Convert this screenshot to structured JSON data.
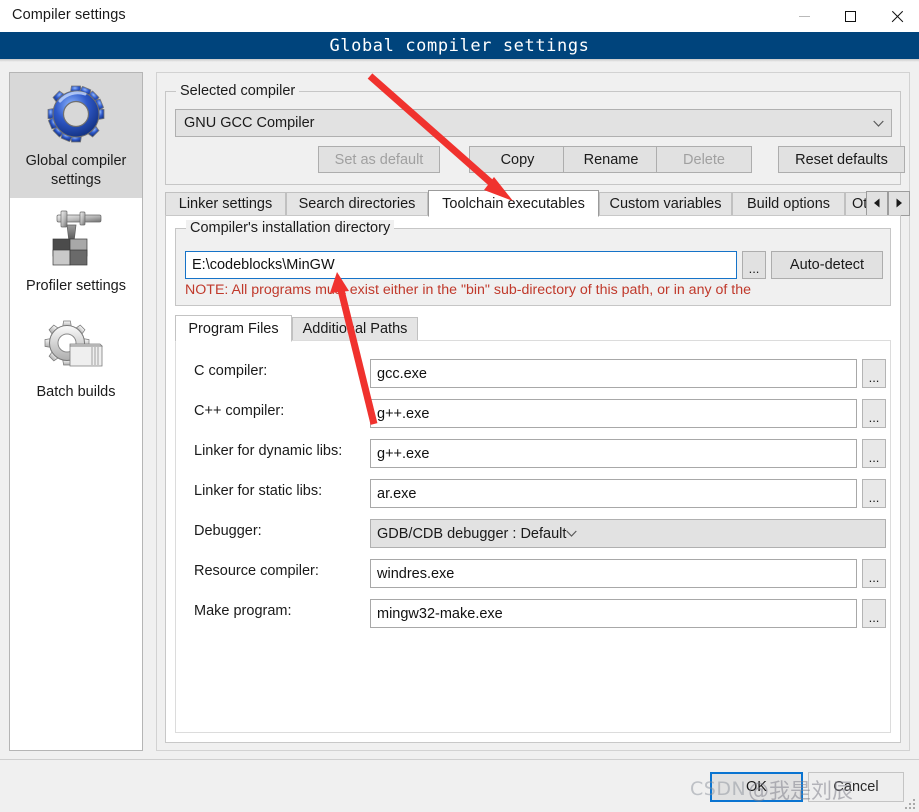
{
  "window": {
    "title": "Compiler settings",
    "minimize_icon": "minimize-icon",
    "maximize_icon": "maximize-icon",
    "close_icon": "close-icon"
  },
  "header": {
    "title": "Global compiler settings"
  },
  "sidebar": {
    "items": [
      {
        "label": "Global compiler settings",
        "icon": "blue-gear-icon",
        "selected": true
      },
      {
        "label": "Profiler settings",
        "icon": "profiler-caliper-icon",
        "selected": false
      },
      {
        "label": "Batch builds",
        "icon": "batch-builds-gear-icon",
        "selected": false
      }
    ]
  },
  "compiler_group": {
    "title": "Selected compiler",
    "selected_compiler": "GNU GCC Compiler",
    "dropdown_icon": "chevron-down-icon",
    "buttons": [
      {
        "label": "Set as default",
        "disabled": true
      },
      {
        "label": "Copy",
        "disabled": false
      },
      {
        "label": "Rename",
        "disabled": false
      },
      {
        "label": "Delete",
        "disabled": true
      },
      {
        "label": "Reset defaults",
        "disabled": false
      }
    ]
  },
  "tabs": {
    "items": [
      {
        "label": "Linker settings",
        "active": false
      },
      {
        "label": "Search directories",
        "active": false
      },
      {
        "label": "Toolchain executables",
        "active": true
      },
      {
        "label": "Custom variables",
        "active": false
      },
      {
        "label": "Build options",
        "active": false
      },
      {
        "label": "Ot",
        "active": false
      }
    ],
    "scroll_left_icon": "triangle-left-icon",
    "scroll_right_icon": "triangle-right-icon"
  },
  "install_dir": {
    "group_title": "Compiler's installation directory",
    "value": "E:\\codeblocks\\MinGW",
    "browse_label": "...",
    "autodetect_label": "Auto-detect",
    "note": "NOTE: All programs must exist either in the \"bin\" sub-directory of this path, or in any of the",
    "note_color": "#c0392b"
  },
  "inner_tabs": {
    "items": [
      {
        "label": "Program Files",
        "active": true
      },
      {
        "label": "Additional Paths",
        "active": false
      }
    ]
  },
  "program_files": {
    "rows": [
      {
        "label": "C compiler:",
        "value": "gcc.exe",
        "type": "text",
        "browse": "..."
      },
      {
        "label": "C++ compiler:",
        "value": "g++.exe",
        "type": "text",
        "browse": "..."
      },
      {
        "label": "Linker for dynamic libs:",
        "value": "g++.exe",
        "type": "text",
        "browse": "..."
      },
      {
        "label": "Linker for static libs:",
        "value": "ar.exe",
        "type": "text",
        "browse": "..."
      },
      {
        "label": "Debugger:",
        "value": "GDB/CDB debugger : Default",
        "type": "combo",
        "browse": ""
      },
      {
        "label": "Resource compiler:",
        "value": "windres.exe",
        "type": "text",
        "browse": "..."
      },
      {
        "label": "Make program:",
        "value": "mingw32-make.exe",
        "type": "text",
        "browse": "..."
      }
    ]
  },
  "footer": {
    "ok_label": "OK",
    "cancel_label": "Cancel"
  },
  "watermark": {
    "brand": "CSDN",
    "user": "@我是刘辰"
  },
  "annotations": {
    "arrow_color": "#f0322e",
    "arrow1": "points from above the Selected compiler box down-right to the Toolchain executables tab",
    "arrow2": "points from the C++ compiler field up-left to the compiler installation directory field"
  }
}
